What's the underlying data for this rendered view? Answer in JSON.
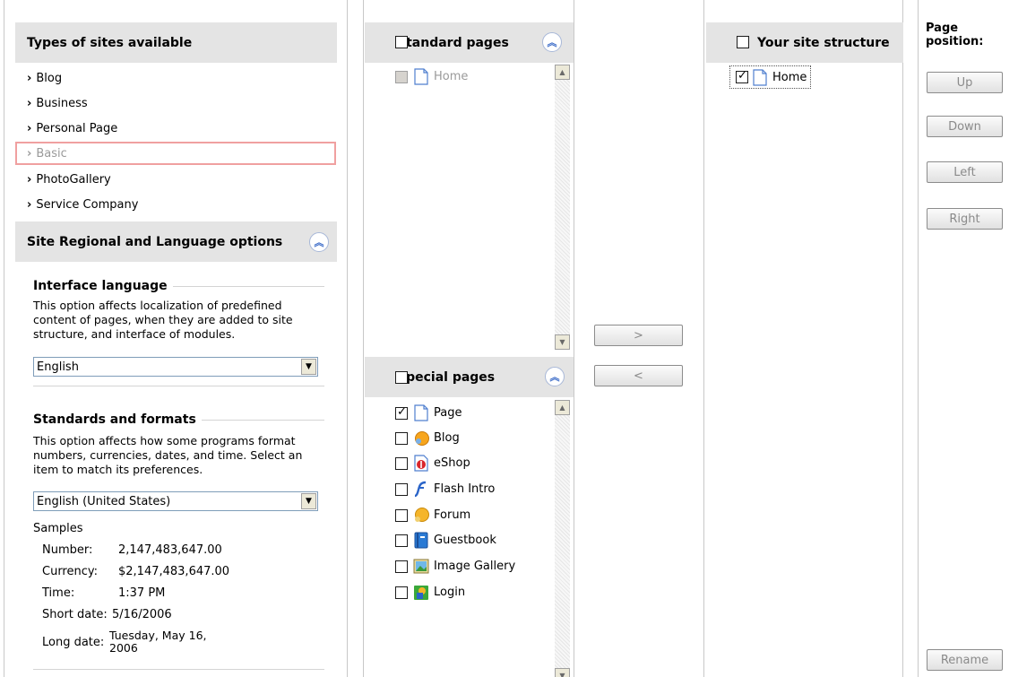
{
  "site_types": {
    "header": "Types of sites available",
    "items": [
      {
        "label": "Blog"
      },
      {
        "label": "Business"
      },
      {
        "label": "Personal Page"
      },
      {
        "label": "Basic",
        "selected": true
      },
      {
        "label": "PhotoGallery"
      },
      {
        "label": "Service Company"
      }
    ]
  },
  "regional": {
    "header": "Site Regional and Language options",
    "interface_language": {
      "title": "Interface language",
      "description": "This option affects localization of predefined content of pages, when they are added to site structure, and interface of modules.",
      "value": "English"
    },
    "standards": {
      "title": "Standards and formats",
      "description": "This option affects how some programs format numbers, currencies, dates, and time. Select an item to match its preferences.",
      "value": "English (United States)"
    },
    "samples": {
      "label": "Samples",
      "rows": [
        {
          "key": "Number:",
          "value": "2,147,483,647.00"
        },
        {
          "key": "Currency:",
          "value": "$2,147,483,647.00"
        },
        {
          "key": "Time:",
          "value": "1:37 PM"
        },
        {
          "key": "Short date:",
          "value": "5/16/2006"
        },
        {
          "key": "Long date:",
          "value": "Tuesday, May 16, 2006"
        }
      ]
    }
  },
  "standard_pages": {
    "header": "Standard pages",
    "items": [
      {
        "label": "Home",
        "checked": false,
        "disabled": true,
        "icon": "page-icon"
      }
    ]
  },
  "special_pages": {
    "header": "Special pages",
    "items": [
      {
        "label": "Page",
        "checked": true,
        "icon": "page-icon"
      },
      {
        "label": "Blog",
        "checked": false,
        "icon": "blog-icon"
      },
      {
        "label": "eShop",
        "checked": false,
        "icon": "eshop-icon"
      },
      {
        "label": "Flash Intro",
        "checked": false,
        "icon": "flash-icon"
      },
      {
        "label": "Forum",
        "checked": false,
        "icon": "forum-icon"
      },
      {
        "label": "Guestbook",
        "checked": false,
        "icon": "guestbook-icon"
      },
      {
        "label": "Image Gallery",
        "checked": false,
        "icon": "image-gallery-icon"
      },
      {
        "label": "Login",
        "checked": false,
        "icon": "login-icon"
      }
    ]
  },
  "transfer": {
    "add_label": ">",
    "remove_label": "<"
  },
  "site_structure": {
    "header": "Your site structure",
    "items": [
      {
        "label": "Home",
        "checked": true,
        "icon": "page-icon"
      }
    ]
  },
  "page_position": {
    "title": "Page position:",
    "up": "Up",
    "down": "Down",
    "left": "Left",
    "right": "Right",
    "rename": "Rename"
  },
  "colors": {
    "header_bg": "#e4e4e4",
    "selected_border": "#f0a0a0",
    "accent": "#3b6bc8"
  }
}
